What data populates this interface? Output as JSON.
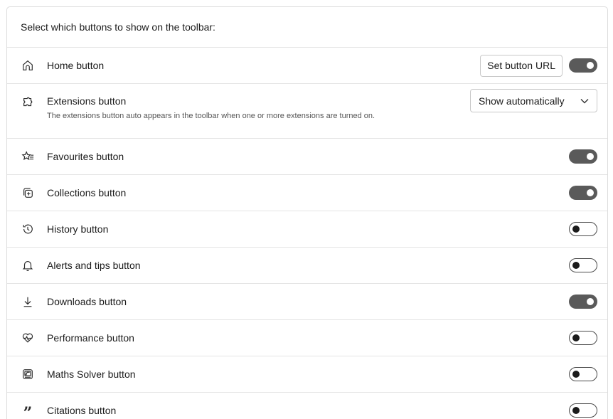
{
  "header": {
    "title": "Select which buttons to show on the toolbar:"
  },
  "home": {
    "label": "Home button",
    "set_url_label": "Set button URL",
    "toggle": "on"
  },
  "extensions": {
    "label": "Extensions button",
    "description": "The extensions button auto appears in the toolbar when one or more extensions are turned on.",
    "select_value": "Show automatically"
  },
  "rows": [
    {
      "label": "Favourites button",
      "icon": "favourites-icon",
      "toggle": "on"
    },
    {
      "label": "Collections button",
      "icon": "collections-icon",
      "toggle": "on"
    },
    {
      "label": "History button",
      "icon": "history-icon",
      "toggle": "off"
    },
    {
      "label": "Alerts and tips button",
      "icon": "bell-icon",
      "toggle": "off"
    },
    {
      "label": "Downloads button",
      "icon": "download-icon",
      "toggle": "on"
    },
    {
      "label": "Performance button",
      "icon": "heartbeat-icon",
      "toggle": "off"
    },
    {
      "label": "Maths Solver button",
      "icon": "math-solver-icon",
      "toggle": "off"
    },
    {
      "label": "Citations button",
      "icon": "quote-icon",
      "toggle": "off"
    }
  ],
  "colors": {
    "toggle_on": "#5a5a5a",
    "border": "#dcdcdc"
  }
}
